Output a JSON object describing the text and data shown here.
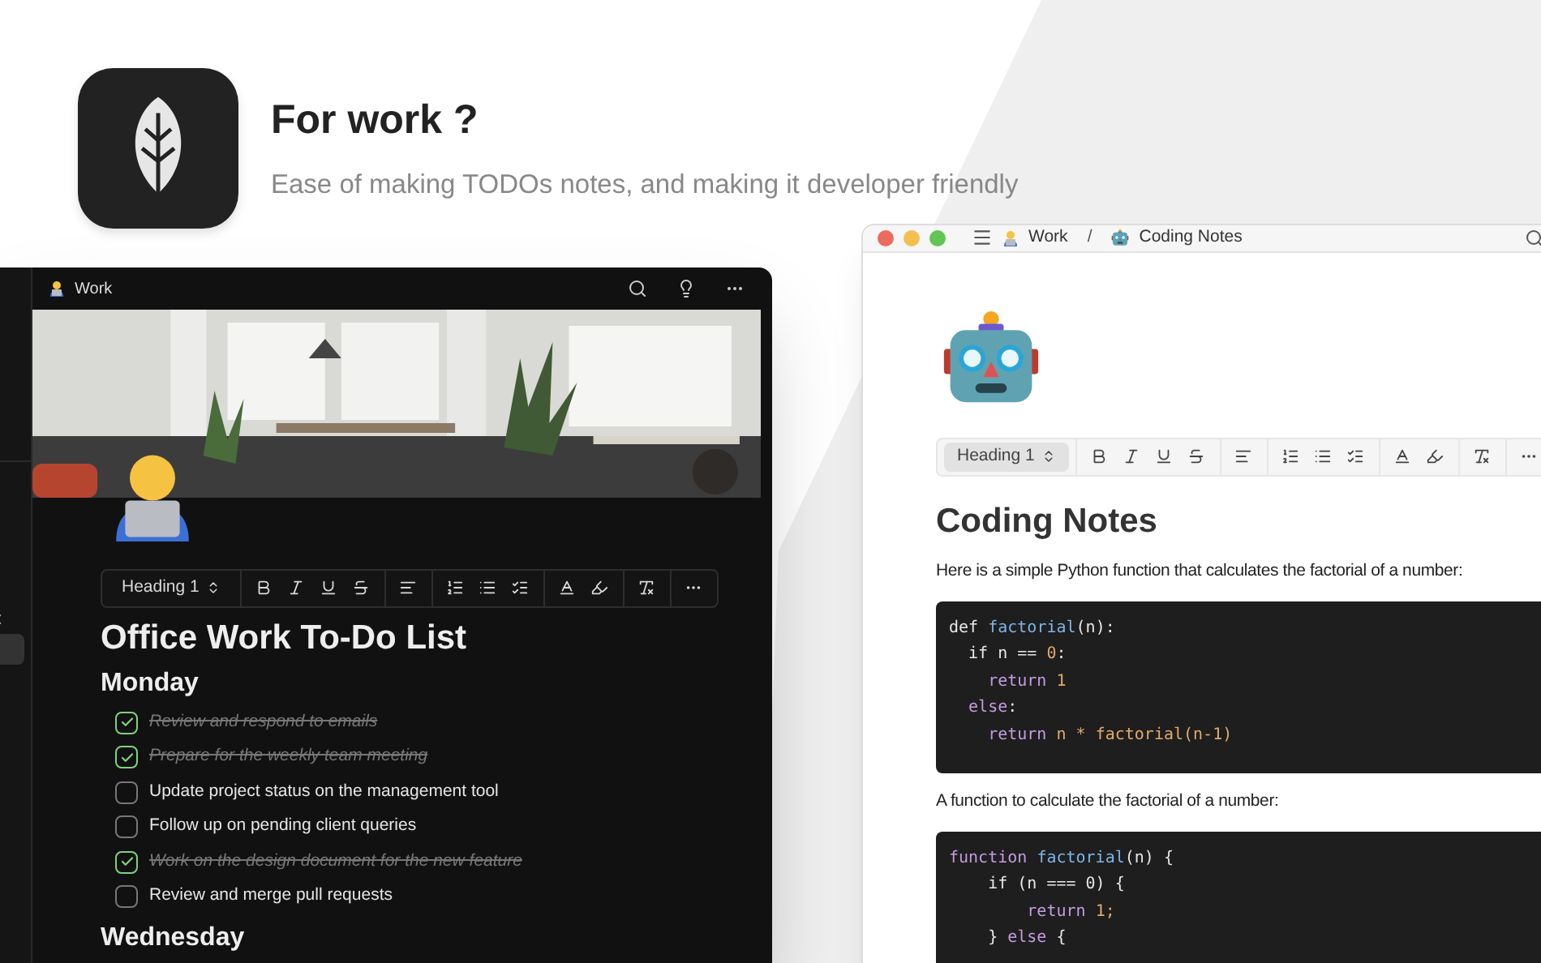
{
  "hero": {
    "title": "For work ?",
    "subtitle": "Ease of making TODOs notes, and making it developer friendly"
  },
  "dark_window": {
    "breadcrumb": "Work",
    "toolbar": {
      "block_style": "Heading 1"
    },
    "title": "Office Work To-Do List",
    "sections": [
      {
        "heading": "Monday",
        "tasks": [
          {
            "text": "Review and respond to emails",
            "checked": true
          },
          {
            "text": "Prepare for the weekly team meeting",
            "checked": true
          },
          {
            "text": "Update project status on the management tool",
            "checked": false
          },
          {
            "text": "Follow up on pending client queries",
            "checked": false
          },
          {
            "text": "Work on the design document for the new feature",
            "checked": true
          },
          {
            "text": "Review and merge pull requests",
            "checked": false
          }
        ]
      },
      {
        "heading": "Wednesday"
      }
    ]
  },
  "light_window": {
    "breadcrumb": [
      {
        "label": "Work"
      },
      {
        "label": "Coding Notes"
      }
    ],
    "separator": "/",
    "toolbar": {
      "block_style": "Heading 1"
    },
    "title": "Coding Notes",
    "blocks": [
      {
        "kind": "paragraph",
        "text": "Here is a simple Python function that calculates the factorial of a number:"
      },
      {
        "kind": "code",
        "lines": [
          [
            {
              "t": "def ",
              "kind": "plain"
            },
            {
              "t": "factorial",
              "kind": "function"
            },
            {
              "t": "(n):",
              "kind": "plain"
            }
          ],
          [
            {
              "t": "  if n == ",
              "kind": "plain"
            },
            {
              "t": "0",
              "kind": "number"
            },
            {
              "t": ":",
              "kind": "plain"
            }
          ],
          [
            {
              "t": "    return ",
              "kind": "keyword"
            },
            {
              "t": "1",
              "kind": "number"
            }
          ],
          [
            {
              "t": "  else",
              "kind": "keyword"
            },
            {
              "t": ":",
              "kind": "plain"
            }
          ],
          [
            {
              "t": "    return ",
              "kind": "keyword"
            },
            {
              "t": "n * factorial(n-1)",
              "kind": "number"
            }
          ]
        ]
      },
      {
        "kind": "paragraph",
        "text": "A function to calculate the factorial of a number:"
      },
      {
        "kind": "code",
        "lines": [
          [
            {
              "t": "function ",
              "kind": "keyword"
            },
            {
              "t": "factorial",
              "kind": "function"
            },
            {
              "t": "(n) {",
              "kind": "plain"
            }
          ],
          [
            {
              "t": "    if (n === 0) {",
              "kind": "plain"
            }
          ],
          [
            {
              "t": "        return ",
              "kind": "keyword"
            },
            {
              "t": "1;",
              "kind": "number"
            }
          ],
          [
            {
              "t": "    } ",
              "kind": "plain"
            },
            {
              "t": "else",
              "kind": "keyword"
            },
            {
              "t": " {",
              "kind": "plain"
            }
          ]
        ]
      }
    ]
  }
}
